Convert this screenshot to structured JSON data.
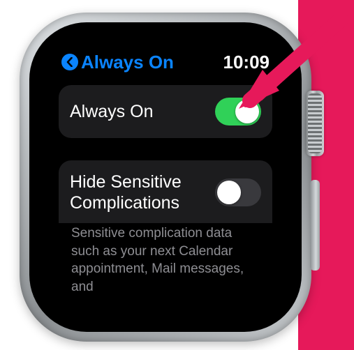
{
  "annotation": {
    "arrow_color": "#e6195a"
  },
  "status": {
    "back_label": "Always On",
    "time": "10:09"
  },
  "rows": {
    "always_on": {
      "label": "Always On",
      "toggle_on": true
    },
    "hide_sensitive": {
      "label": "Hide Sensitive Complications",
      "toggle_on": false
    }
  },
  "descriptions": {
    "hide_sensitive": "Sensitive complication data such as your next Calendar appointment, Mail messages, and"
  }
}
